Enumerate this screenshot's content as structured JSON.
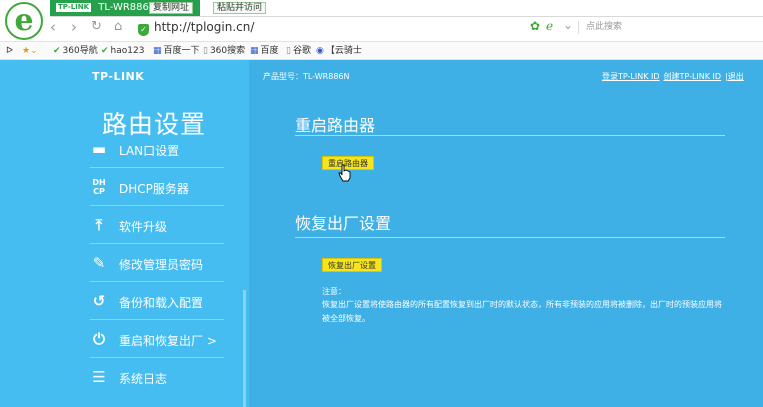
{
  "browser": {
    "tab_title": "TL-WR886N",
    "tab_badge": "TP-LINK",
    "tab_actions": [
      "复制网址",
      "粘贴并访问"
    ],
    "address": "http://tplogin.cn/",
    "search_placeholder": "点此搜索",
    "bookmarks": [
      "360导航",
      "hao123",
      "百度一下",
      "360搜索",
      "百度",
      "谷歌",
      "【云骑士"
    ]
  },
  "router": {
    "brand": "TP-LINK",
    "sidebar_title": "路由设置",
    "model_label": "产品型号：TL-WR886N",
    "top_links": [
      "登录TP-LINK ID",
      "创建TP-LINK ID",
      "|退出"
    ],
    "menu": [
      {
        "label": "LAN口设置",
        "icon": "lan-icon"
      },
      {
        "label": "DHCP服务器",
        "icon": "dhcp-icon"
      },
      {
        "label": "软件升级",
        "icon": "upload-icon"
      },
      {
        "label": "修改管理员密码",
        "icon": "pencil-icon"
      },
      {
        "label": "备份和载入配置",
        "icon": "history-icon"
      },
      {
        "label": "重启和恢复出厂 >",
        "icon": "power-icon"
      },
      {
        "label": "系统日志",
        "icon": "list-icon"
      }
    ],
    "reboot": {
      "title": "重启路由器",
      "button": "重启路由器"
    },
    "factory": {
      "title": "恢复出厂设置",
      "button": "恢复出厂设置",
      "note_title": "注意：",
      "note_body": "恢复出厂设置将使路由器的所有配置恢复到出厂时的默认状态，所有非预装的应用将被删除，出厂时的预装应用将被全部恢复。"
    },
    "colors": {
      "page_bg": "#3fb0e5",
      "sidebar_bg": "#46bdf0",
      "button_bg": "#f6e51c"
    }
  }
}
